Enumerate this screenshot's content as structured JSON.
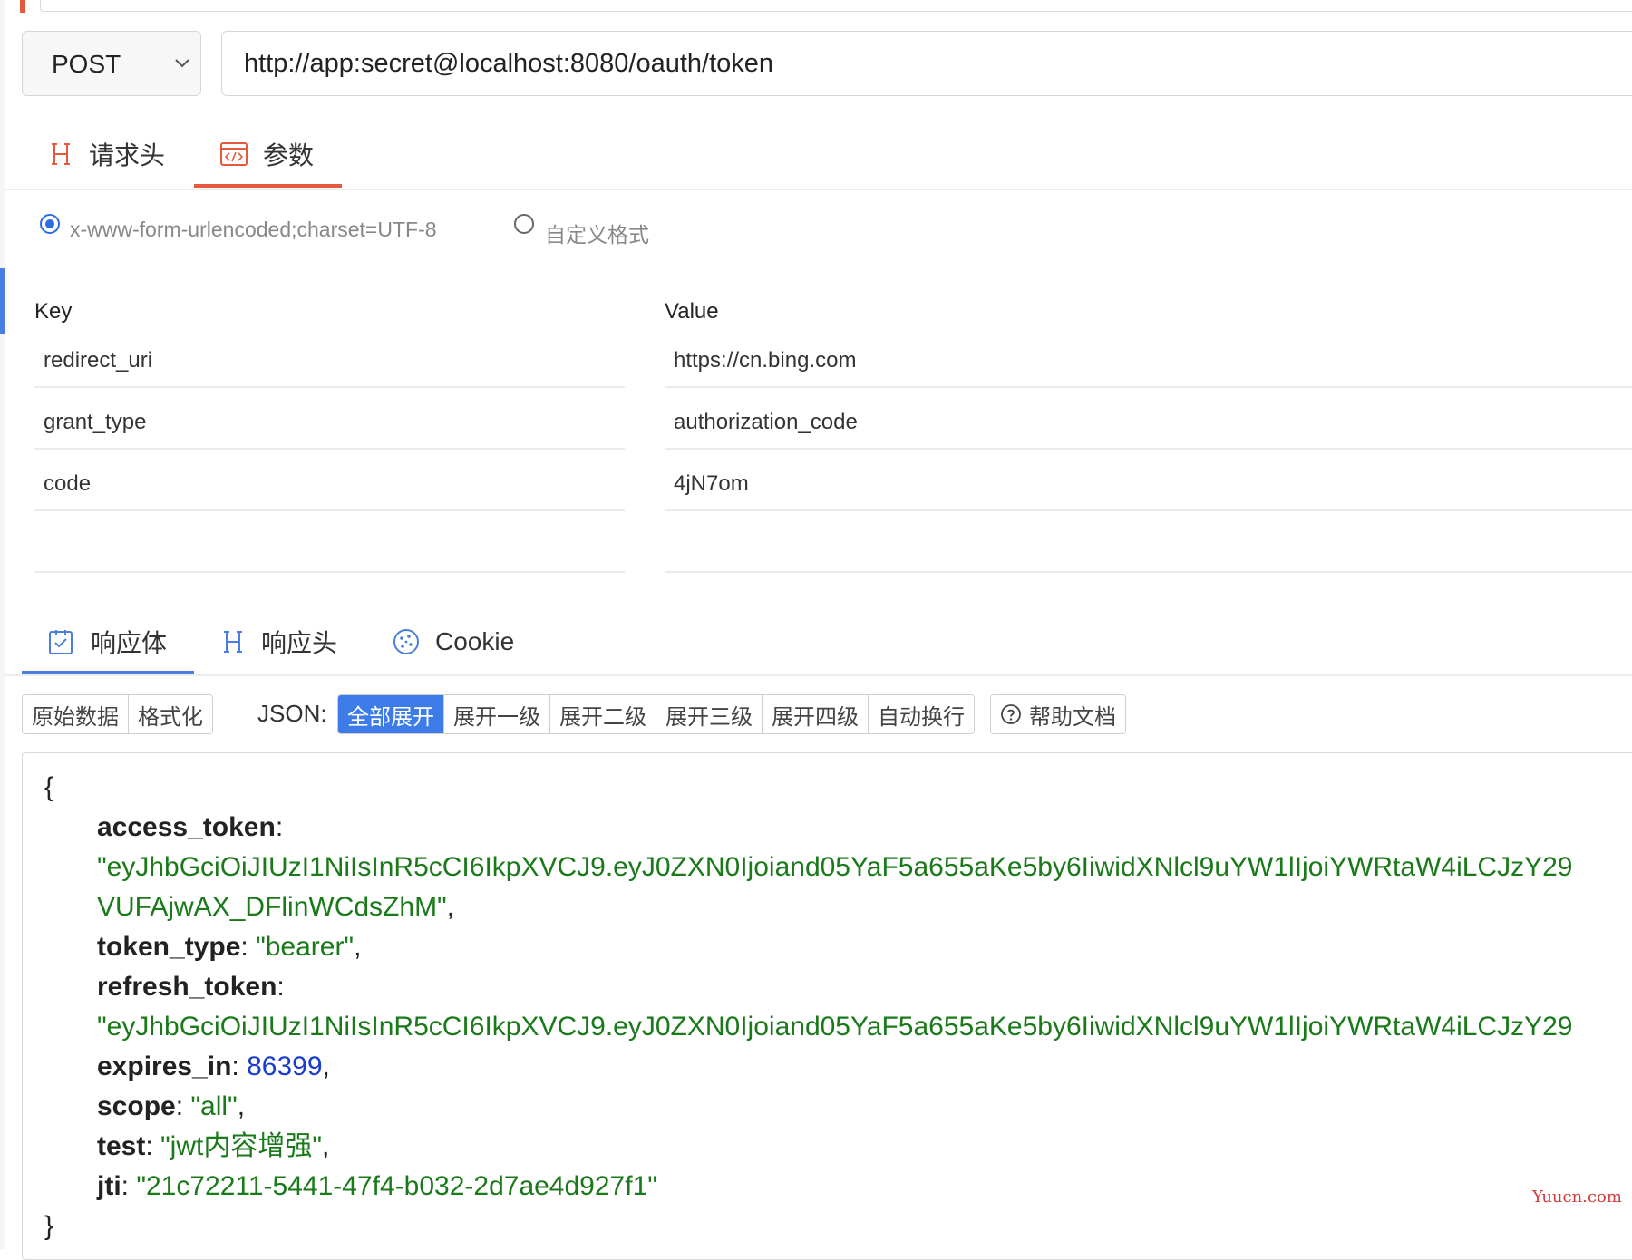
{
  "request": {
    "method": "POST",
    "url": "http://app:secret@localhost:8080/oauth/token",
    "tabs": [
      {
        "label": "请求头",
        "icon": "header-h-icon"
      },
      {
        "label": "参数",
        "icon": "code-window-icon",
        "active": true
      }
    ],
    "body_format": {
      "options": [
        {
          "label": "x-www-form-urlencoded;charset=UTF-8",
          "selected": true
        },
        {
          "label": "自定义格式",
          "selected": false
        }
      ]
    },
    "params": {
      "key_header": "Key",
      "value_header": "Value",
      "rows": [
        {
          "key": "redirect_uri",
          "value": "https://cn.bing.com"
        },
        {
          "key": "grant_type",
          "value": "authorization_code"
        },
        {
          "key": "code",
          "value": "4jN7om"
        },
        {
          "key": "",
          "value": ""
        }
      ]
    }
  },
  "response": {
    "tabs": [
      {
        "label": "响应体",
        "icon": "checkbox-doc-icon",
        "active": true
      },
      {
        "label": "响应头",
        "icon": "header-h-icon"
      },
      {
        "label": "Cookie",
        "icon": "cookie-icon"
      }
    ],
    "view_buttons": [
      "原始数据",
      "格式化"
    ],
    "json_label": "JSON:",
    "json_buttons": [
      "全部展开",
      "展开一级",
      "展开二级",
      "展开三级",
      "展开四级",
      "自动换行"
    ],
    "active_json_button": "全部展开",
    "help_button": "帮助文档",
    "body": {
      "open_brace": "{",
      "close_brace": "}",
      "access_token_key": "access_token",
      "access_token_line1": "\"eyJhbGciOiJIUzI1NiIsInR5cCI6IkpXVCJ9.eyJ0ZXN0Ijoiand05YaF5a655aKe5by6IiwidXNlcl9uYW1lIjoiYWRtaW4iLCJzY29",
      "access_token_line2": "VUFAjwAX_DFlinWCdsZhM\"",
      "token_type_key": "token_type",
      "token_type_value": "\"bearer\"",
      "refresh_token_key": "refresh_token",
      "refresh_token_line1": "\"eyJhbGciOiJIUzI1NiIsInR5cCI6IkpXVCJ9.eyJ0ZXN0Ijoiand05YaF5a655aKe5by6IiwidXNlcl9uYW1lIjoiYWRtaW4iLCJzY29",
      "expires_in_key": "expires_in",
      "expires_in_value": "86399",
      "scope_key": "scope",
      "scope_value": "\"all\"",
      "test_key": "test",
      "test_value": "\"jwt内容增强\"",
      "jti_key": "jti",
      "jti_value": "\"21c72211-5441-47f4-b032-2d7ae4d927f1\""
    }
  },
  "watermark": "Yuucn.com",
  "colors": {
    "accent_orange": "#e55a3c",
    "accent_blue": "#4a7ee0",
    "active_button": "#3d7ce8",
    "json_string": "#1a7a1a",
    "json_number": "#1a3ccc"
  }
}
